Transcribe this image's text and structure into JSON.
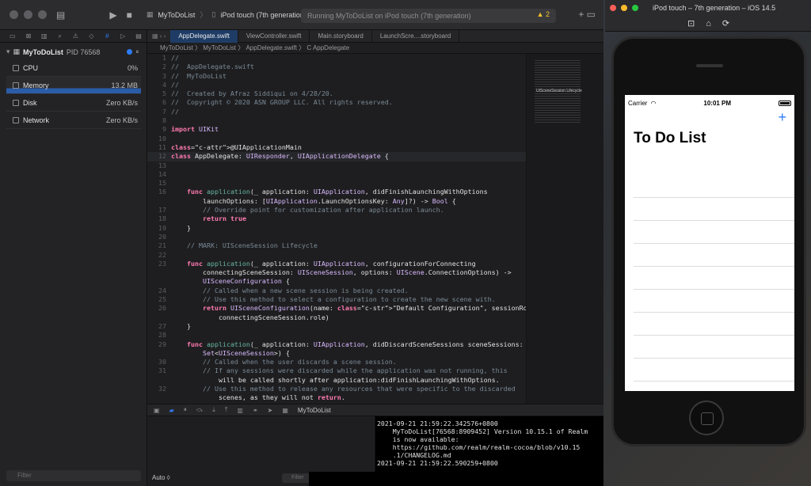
{
  "toolbar": {
    "scheme": "MyToDoList",
    "device": "iPod touch (7th generation)",
    "status": "Running MyToDoList on iPod touch (7th generation)"
  },
  "tabs": [
    {
      "label": "AppDelegate.swift",
      "active": true
    },
    {
      "label": "ViewController.swift",
      "active": false
    },
    {
      "label": "Main.storyboard",
      "active": false
    },
    {
      "label": "LaunchScre....storyboard",
      "active": false
    }
  ],
  "jump_bar": "MyToDoList  〉  MyToDoList  〉  AppDelegate.swift  〉  C  AppDelegate",
  "navigator": {
    "process_name": "MyToDoList",
    "pid": "PID 76568",
    "metrics": [
      {
        "label": "CPU",
        "value": "0%"
      },
      {
        "label": "Memory",
        "value": "13.2 MB"
      },
      {
        "label": "Disk",
        "value": "Zero KB/s"
      },
      {
        "label": "Network",
        "value": "Zero KB/s"
      }
    ],
    "filter_placeholder": "Filter"
  },
  "code_lines": [
    {
      "n": "1",
      "t": "//"
    },
    {
      "n": "2",
      "t": "//  AppDelegate.swift"
    },
    {
      "n": "3",
      "t": "//  MyToDoList"
    },
    {
      "n": "4",
      "t": "//"
    },
    {
      "n": "5",
      "t": "//  Created by Afraz Siddiqui on 4/28/20."
    },
    {
      "n": "6",
      "t": "//  Copyright © 2020 ASN GROUP LLC. All rights reserved."
    },
    {
      "n": "7",
      "t": "//"
    },
    {
      "n": "8",
      "t": ""
    },
    {
      "n": "9",
      "t": "import UIKit"
    },
    {
      "n": "10",
      "t": ""
    },
    {
      "n": "11",
      "t": "@UIApplicationMain"
    },
    {
      "n": "12",
      "t": "class AppDelegate: UIResponder, UIApplicationDelegate {"
    },
    {
      "n": "13",
      "t": ""
    },
    {
      "n": "14",
      "t": ""
    },
    {
      "n": "15",
      "t": ""
    },
    {
      "n": "16",
      "t": "    func application(_ application: UIApplication, didFinishLaunchingWithOptions"
    },
    {
      "n": "",
      "t": "        launchOptions: [UIApplication.LaunchOptionsKey: Any]?) -> Bool {"
    },
    {
      "n": "17",
      "t": "        // Override point for customization after application launch."
    },
    {
      "n": "18",
      "t": "        return true"
    },
    {
      "n": "19",
      "t": "    }"
    },
    {
      "n": "20",
      "t": ""
    },
    {
      "n": "21",
      "t": "    // MARK: UISceneSession Lifecycle"
    },
    {
      "n": "22",
      "t": ""
    },
    {
      "n": "23",
      "t": "    func application(_ application: UIApplication, configurationForConnecting"
    },
    {
      "n": "",
      "t": "        connectingSceneSession: UISceneSession, options: UIScene.ConnectionOptions) ->"
    },
    {
      "n": "",
      "t": "        UISceneConfiguration {"
    },
    {
      "n": "24",
      "t": "        // Called when a new scene session is being created."
    },
    {
      "n": "25",
      "t": "        // Use this method to select a configuration to create the new scene with."
    },
    {
      "n": "26",
      "t": "        return UISceneConfiguration(name: \"Default Configuration\", sessionRole:"
    },
    {
      "n": "",
      "t": "            connectingSceneSession.role)"
    },
    {
      "n": "27",
      "t": "    }"
    },
    {
      "n": "28",
      "t": ""
    },
    {
      "n": "29",
      "t": "    func application(_ application: UIApplication, didDiscardSceneSessions sceneSessions:"
    },
    {
      "n": "",
      "t": "        Set<UISceneSession>) {"
    },
    {
      "n": "30",
      "t": "        // Called when the user discards a scene session."
    },
    {
      "n": "31",
      "t": "        // If any sessions were discarded while the application was not running, this"
    },
    {
      "n": "",
      "t": "            will be called shortly after application:didFinishLaunchingWithOptions."
    },
    {
      "n": "32",
      "t": "        // Use this method to release any resources that were specific to the discarded"
    },
    {
      "n": "",
      "t": "            scenes, as they will not return."
    }
  ],
  "minimap_label": "UISceneSession Lifecycle",
  "debug": {
    "target": "MyToDoList",
    "auto_label": "Auto ◊",
    "filter_placeholder": "Filter"
  },
  "console_lines": [
    "2021-09-21 21:59:22.342576+0800",
    "    MyToDoList[76568:8909452] Version 10.15.1 of Realm",
    "    is now available:",
    "    https://github.com/realm/realm-cocoa/blob/v10.15",
    "    .1/CHANGELOG.md",
    "2021-09-21 21:59:22.590259+0800"
  ],
  "simulator": {
    "title": "iPod touch – 7th generation – iOS 14.5",
    "carrier": "Carrier",
    "time": "10:01 PM",
    "heading": "To Do List",
    "add_symbol": "+"
  },
  "colors": {
    "accent": "#2f7bf5",
    "keyword": "#ff7ab2",
    "comment": "#7a8a96",
    "string": "#ff8170"
  }
}
